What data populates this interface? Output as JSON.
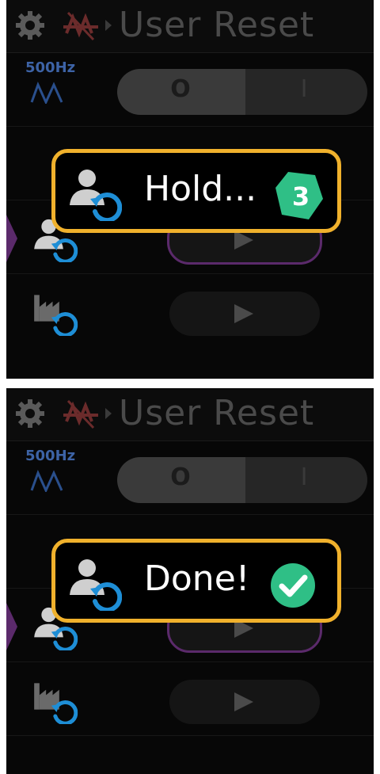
{
  "screens": [
    {
      "header": {
        "title": "User Reset"
      },
      "frequency": {
        "value": "500Hz"
      },
      "toggle": {
        "off_label": "O",
        "on_label": "I"
      },
      "popup": {
        "message": "Hold...",
        "countdown": "3"
      }
    },
    {
      "header": {
        "title": "User Reset"
      },
      "frequency": {
        "value": "500Hz"
      },
      "toggle": {
        "off_label": "O",
        "on_label": "I"
      },
      "popup": {
        "message": "Done!"
      }
    }
  ],
  "colors": {
    "accent_popup_border": "#f0b12c",
    "badge_green": "#2fbf86",
    "selection_purple": "#5b2a6b",
    "icon_blue": "#1e8ed6"
  },
  "icons": [
    "gear-icon",
    "signal-off-icon",
    "chevron-right-icon",
    "sine-wave-icon",
    "user-reset-icon",
    "factory-reset-icon",
    "play-icon",
    "countdown-badge-icon",
    "check-circle-icon"
  ]
}
